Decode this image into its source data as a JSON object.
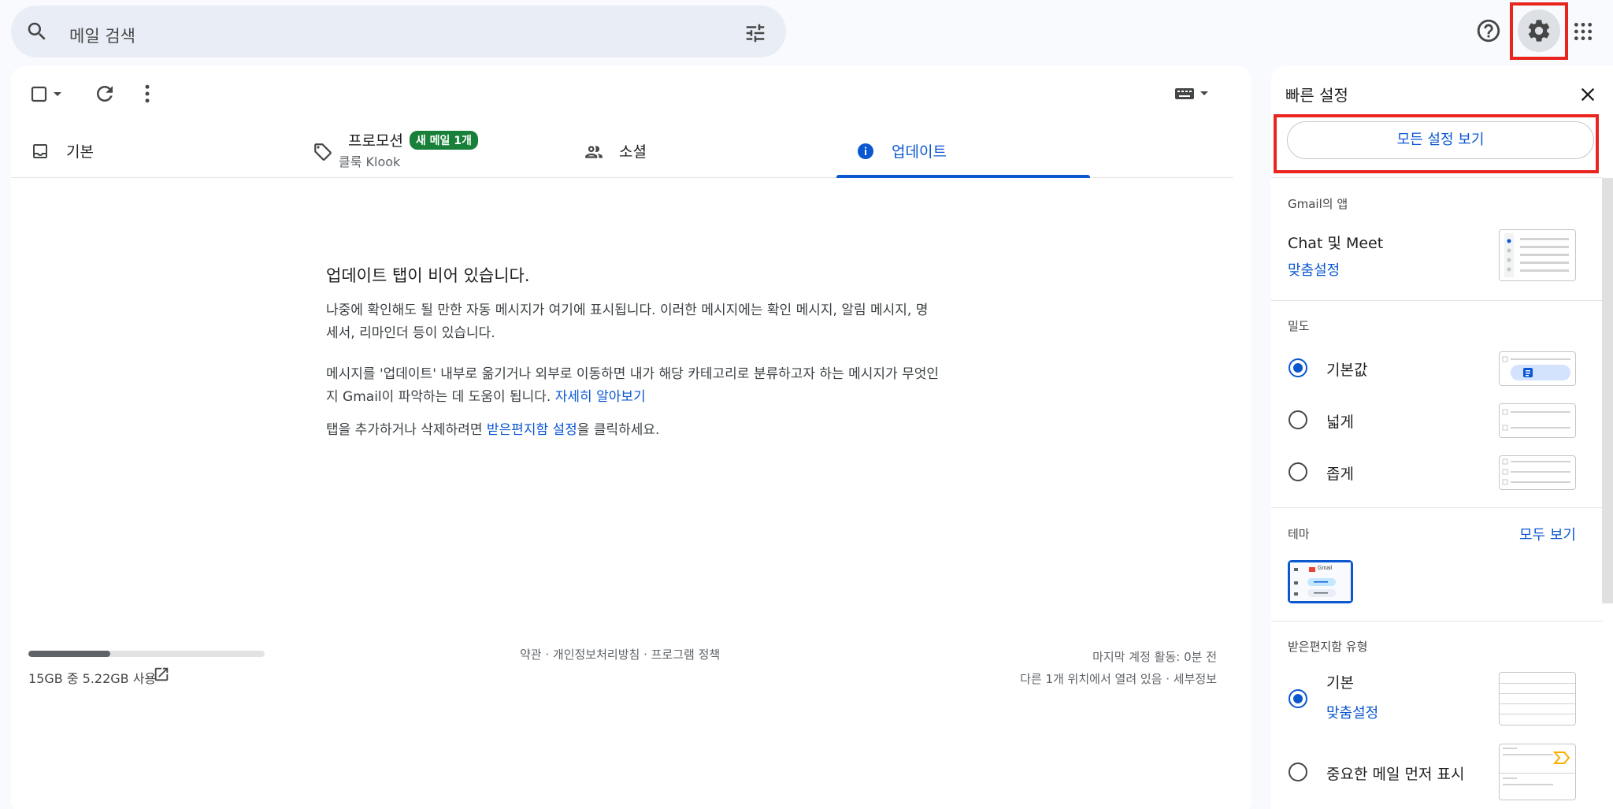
{
  "search": {
    "placeholder": "메일 검색"
  },
  "tabs": [
    {
      "label": "기본"
    },
    {
      "label": "프로모션",
      "badge": "새 메일 1개",
      "sub": "클룩 Klook"
    },
    {
      "label": "소셜"
    },
    {
      "label": "업데이트",
      "active": true
    }
  ],
  "empty_state": {
    "title": "업데이트 탭이 비어 있습니다.",
    "p1": "나중에 확인해도 될 만한 자동 메시지가 여기에 표시됩니다. 이러한 메시지에는 확인 메시지, 알림 메시지, 명세서, 리마인더 등이 있습니다.",
    "p2": "메시지를 '업데이트' 내부로 옮기거나 외부로 이동하면 내가 해당 카테고리로 분류하고자 하는 메시지가 무엇인지 Gmail이 파악하는 데 도움이 됩니다.",
    "p2_link": "자세히 알아보기",
    "p3_before": "탭을 추가하거나 삭제하려면 ",
    "p3_link": "받은편지함 설정",
    "p3_after": "을 클릭하세요."
  },
  "footer": {
    "storage": "15GB 중 5.22GB 사용",
    "storage_used_fraction": 0.348,
    "links": "약관 · 개인정보처리방침 · 프로그램 정책",
    "last_activity": "마지막 계정 활동: 0분 전",
    "details": "다른 1개 위치에서 열려 있음 · 세부정보"
  },
  "quick_settings": {
    "title": "빠른 설정",
    "all_settings": "모든 설정 보기",
    "apps_label": "Gmail의 앱",
    "apps_item": "Chat 및 Meet",
    "customize": "맞춤설정",
    "density_label": "밀도",
    "density_options": [
      "기본값",
      "넓게",
      "좁게"
    ],
    "density_selected": 0,
    "theme_label": "테마",
    "theme_view_all": "모두 보기",
    "theme_thumb_text": "Gmail",
    "inbox_type_label": "받은편지함 유형",
    "inbox_default": "기본",
    "inbox_customize": "맞춤설정",
    "inbox_important": "중요한 메일 먼저 표시"
  },
  "colors": {
    "accent": "#0b57d0",
    "highlight": "#e8261f",
    "badge": "#188038"
  }
}
